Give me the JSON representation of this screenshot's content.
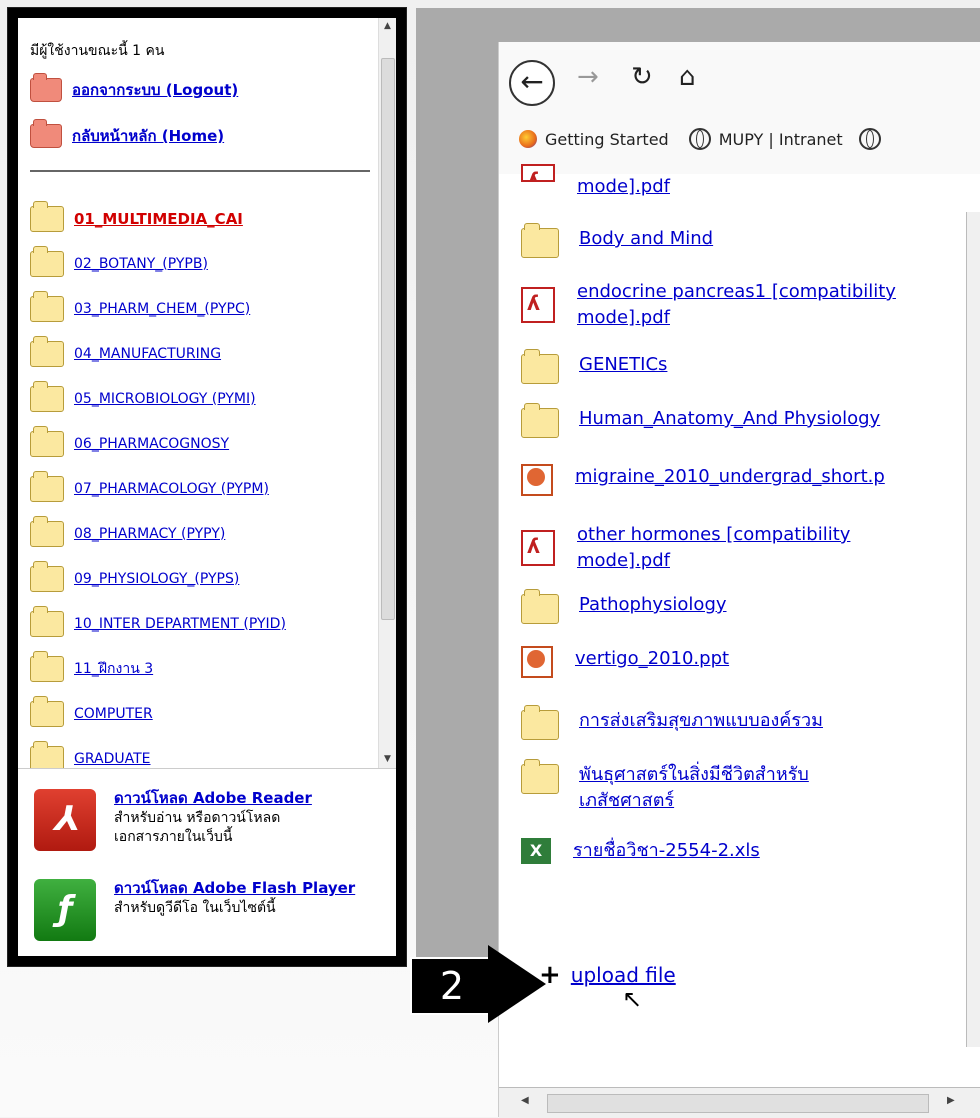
{
  "left": {
    "online_text": "มีผู้ใช้งานขณะนี้ 1 คน",
    "logout": "ออกจากระบบ (Logout)",
    "home": "กลับหน้าหลัก (Home)",
    "categories": [
      {
        "label": "01_MULTIMEDIA_CAI",
        "active": true
      },
      {
        "label": "02_BOTANY_(PYPB)"
      },
      {
        "label": "03_PHARM_CHEM_(PYPC)"
      },
      {
        "label": "04_MANUFACTURING"
      },
      {
        "label": "05_MICROBIOLOGY (PYMI)"
      },
      {
        "label": "06_PHARMACOGNOSY"
      },
      {
        "label": "07_PHARMACOLOGY (PYPM)"
      },
      {
        "label": "08_PHARMACY (PYPY)"
      },
      {
        "label": "09_PHYSIOLOGY_(PYPS)"
      },
      {
        "label": "10_INTER DEPARTMENT (PYID)"
      },
      {
        "label": "11_ฝึกงาน 3"
      },
      {
        "label": "COMPUTER"
      },
      {
        "label": "GRADUATE"
      }
    ],
    "downloads": [
      {
        "title": "ดาวน์โหลด Adobe Reader",
        "desc1": "สำหรับอ่าน หรือดาวน์โหลด",
        "desc2": "เอกสารภายในเว็บนี้",
        "icon": "adobe-reader-icon"
      },
      {
        "title": "ดาวน์โหลด Adobe Flash Player",
        "desc1": "สำหรับดูวีดีโอ ในเว็บไซต์นี้",
        "desc2": "",
        "icon": "adobe-flash-icon"
      }
    ]
  },
  "browser": {
    "bookmarks": [
      "Getting Started",
      "MUPY | Intranet"
    ],
    "files": [
      {
        "name": "mode].pdf",
        "type": "pdf"
      },
      {
        "name": "Body and Mind",
        "type": "folder"
      },
      {
        "name": "endocrine pancreas1 [compatibility mode].pdf",
        "type": "pdf"
      },
      {
        "name": "GENETICs",
        "type": "folder"
      },
      {
        "name": "Human_Anatomy_And Physiology",
        "type": "folder"
      },
      {
        "name": "migraine_2010_undergrad_short.p",
        "type": "ppt"
      },
      {
        "name": "other hormones [compatibility mode].pdf",
        "type": "pdf"
      },
      {
        "name": "Pathophysiology",
        "type": "folder"
      },
      {
        "name": "vertigo_2010.ppt",
        "type": "ppt"
      },
      {
        "name": "การส่งเสริมสุขภาพแบบองค์รวม",
        "type": "folder"
      },
      {
        "name": "พันธุศาสตร์ในสิ่งมีชีวิตสำหรับเภสัชศาสตร์",
        "type": "folder"
      },
      {
        "name": "รายชื่อวิชา-2554-2.xls",
        "type": "xls"
      }
    ],
    "upload": "upload file",
    "step_number": "2"
  }
}
